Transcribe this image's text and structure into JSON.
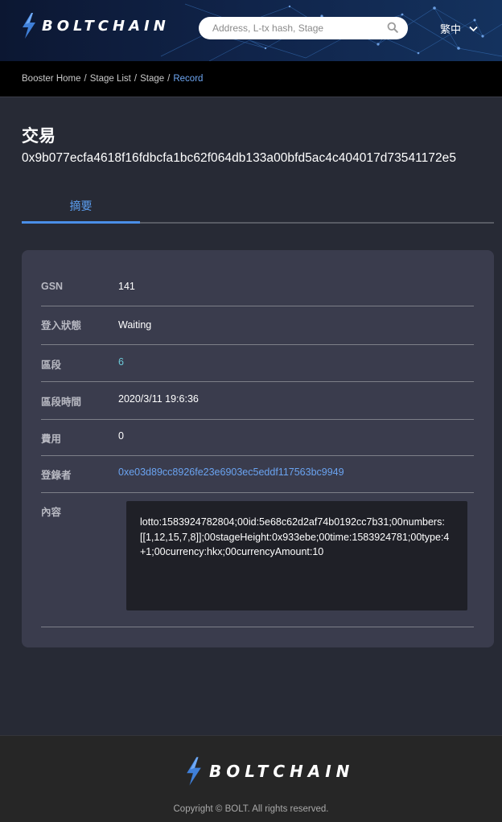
{
  "header": {
    "brand": "BOLTCHAIN",
    "search": {
      "placeholder": "Address, L-tx hash, Stage",
      "value": ""
    },
    "language": "繁中"
  },
  "breadcrumb": {
    "items": [
      "Booster Home",
      "Stage List",
      "Stage"
    ],
    "current": "Record",
    "separator": "/"
  },
  "page": {
    "title": "交易",
    "tx_hash": "0x9b077ecfa4618f16fdbcfa1bc62f064db133a00bfd5ac4c404017d73541172e5"
  },
  "tabs": [
    {
      "label": "摘要",
      "active": true
    }
  ],
  "details": {
    "gsn": {
      "label": "GSN",
      "value": "141"
    },
    "status": {
      "label": "登入狀態",
      "value": "Waiting"
    },
    "stage": {
      "label": "區段",
      "value": "6"
    },
    "stage_time": {
      "label": "區段時間",
      "value": "2020/3/11 19:6:36"
    },
    "fee": {
      "label": "費用",
      "value": "0"
    },
    "registrant": {
      "label": "登錄者",
      "value": "0xe03d89cc8926fe23e6903ec5eddf117563bc9949"
    },
    "content": {
      "label": "內容",
      "value": "lotto:1583924782804;00id:5e68c62d2af74b0192cc7b31;00numbers:[[1,12,15,7,8]];00stageHeight:0x933ebe;00time:1583924781;00type:4+1;00currency:hkx;00currencyAmount:10"
    }
  },
  "footer": {
    "brand": "BOLTCHAIN",
    "copyright": "Copyright © BOLT. All rights reserved."
  },
  "colors": {
    "background": "#272a35",
    "card": "#3a3c4d",
    "link": "#6aa3f0",
    "accent_tab": "#4a8fe8",
    "stage_link": "#6cc9d8"
  },
  "icons": [
    "bolt-logo-icon",
    "search-icon",
    "chevron-down-icon"
  ]
}
